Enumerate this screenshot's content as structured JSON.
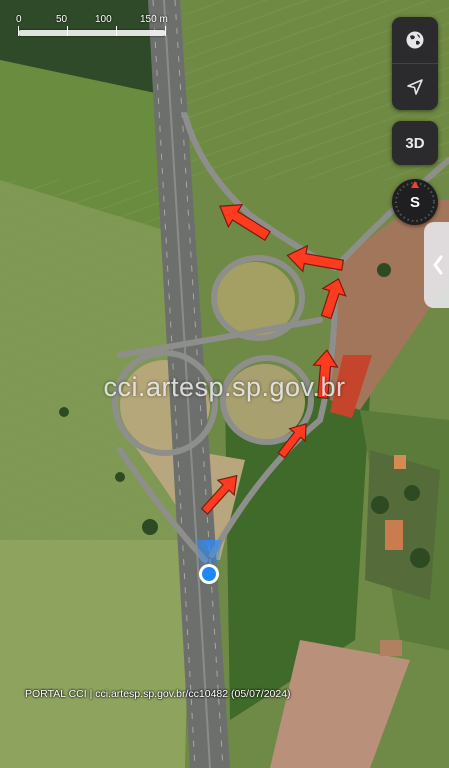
{
  "map": {
    "watermark": "cci.artesp.sp.gov.br",
    "credit": "PORTAL CCI | cci.artesp.sp.gov.br/cc10482 (05/07/2024)",
    "scale_labels": [
      "0",
      "50",
      "100",
      "150 m"
    ],
    "arrow_color": "#ff3b1f",
    "location_dot_color": "#1e88f5"
  },
  "controls": {
    "layers_icon": "globe-icon",
    "locate_icon": "location-arrow-icon",
    "view_3d_label": "3D",
    "compass_label": "S",
    "side_panel_icon": "chevron-left-icon"
  }
}
